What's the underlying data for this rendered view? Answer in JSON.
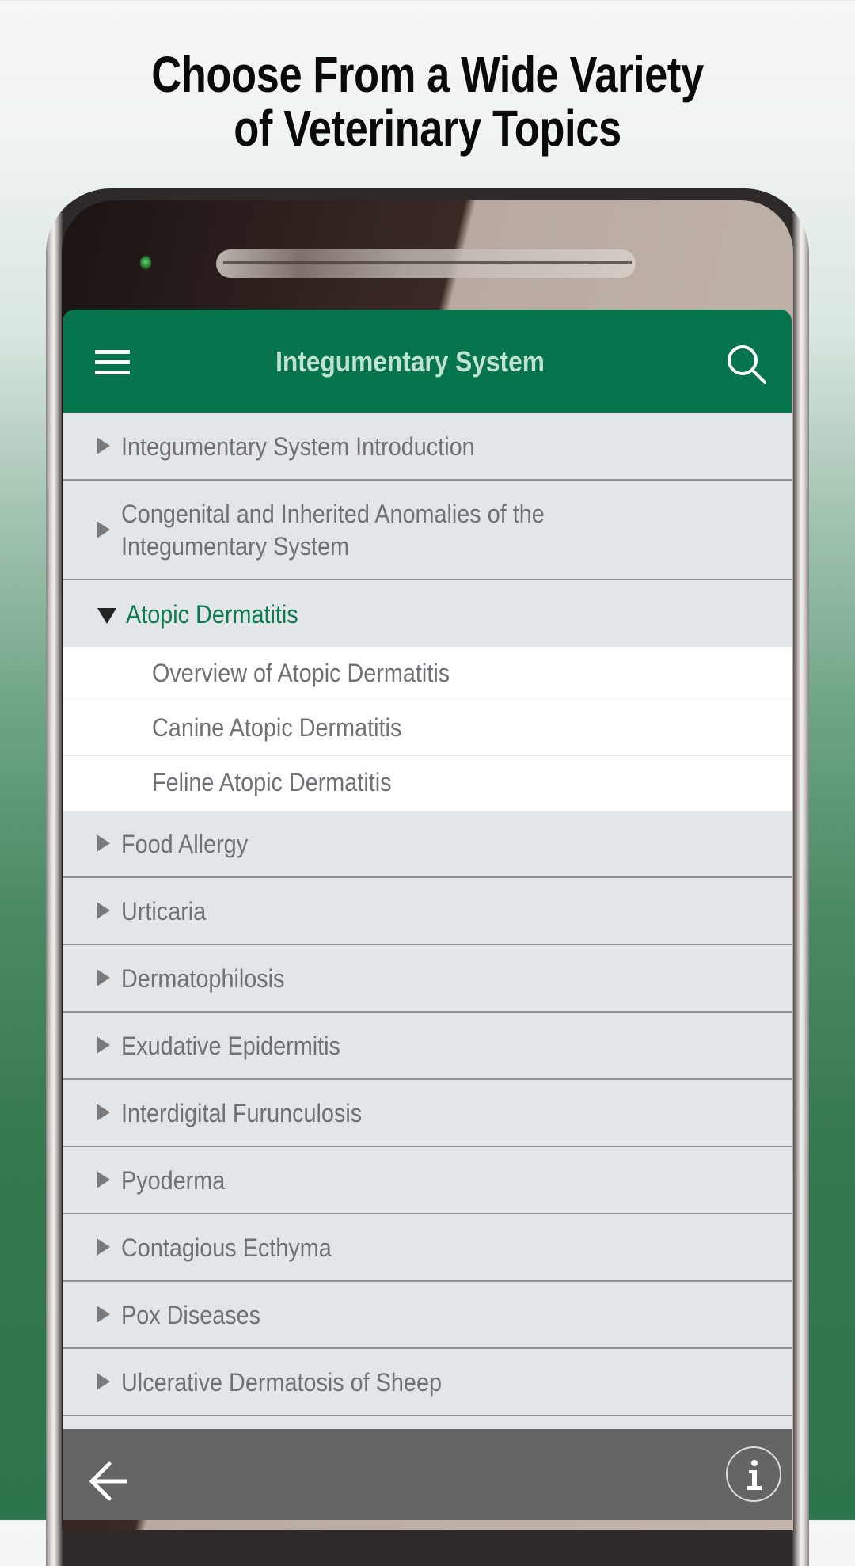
{
  "promo": {
    "headline_line1": "Choose From a Wide Variety",
    "headline_line2": "of Veterinary Topics"
  },
  "appbar": {
    "menu_icon": "hamburger-menu-icon",
    "title": "Integumentary System",
    "search_icon": "search-icon"
  },
  "topics": [
    {
      "label": "Integumentary System Introduction",
      "expanded": false
    },
    {
      "label_line1": "Congenital and Inherited Anomalies of the",
      "label_line2": "Integumentary System",
      "expanded": false
    },
    {
      "label": "Atopic Dermatitis",
      "expanded": true,
      "children": [
        {
          "label": "Overview of Atopic Dermatitis"
        },
        {
          "label": "Canine Atopic Dermatitis"
        },
        {
          "label": "Feline Atopic Dermatitis"
        }
      ]
    },
    {
      "label": "Food Allergy",
      "expanded": false
    },
    {
      "label": "Urticaria",
      "expanded": false
    },
    {
      "label": "Dermatophilosis",
      "expanded": false
    },
    {
      "label": "Exudative Epidermitis",
      "expanded": false
    },
    {
      "label": "Interdigital Furunculosis",
      "expanded": false
    },
    {
      "label": "Pyoderma",
      "expanded": false
    },
    {
      "label": "Contagious Ecthyma",
      "expanded": false
    },
    {
      "label": "Pox Diseases",
      "expanded": false
    },
    {
      "label": "Ulcerative Dermatosis of Sheep",
      "expanded": false
    }
  ],
  "footer": {
    "back_icon": "back-arrow-icon",
    "info_icon": "info-icon"
  },
  "colors": {
    "brand_green": "#06744c",
    "active_topic": "#0b7a4e",
    "footer_gray": "#656565"
  }
}
